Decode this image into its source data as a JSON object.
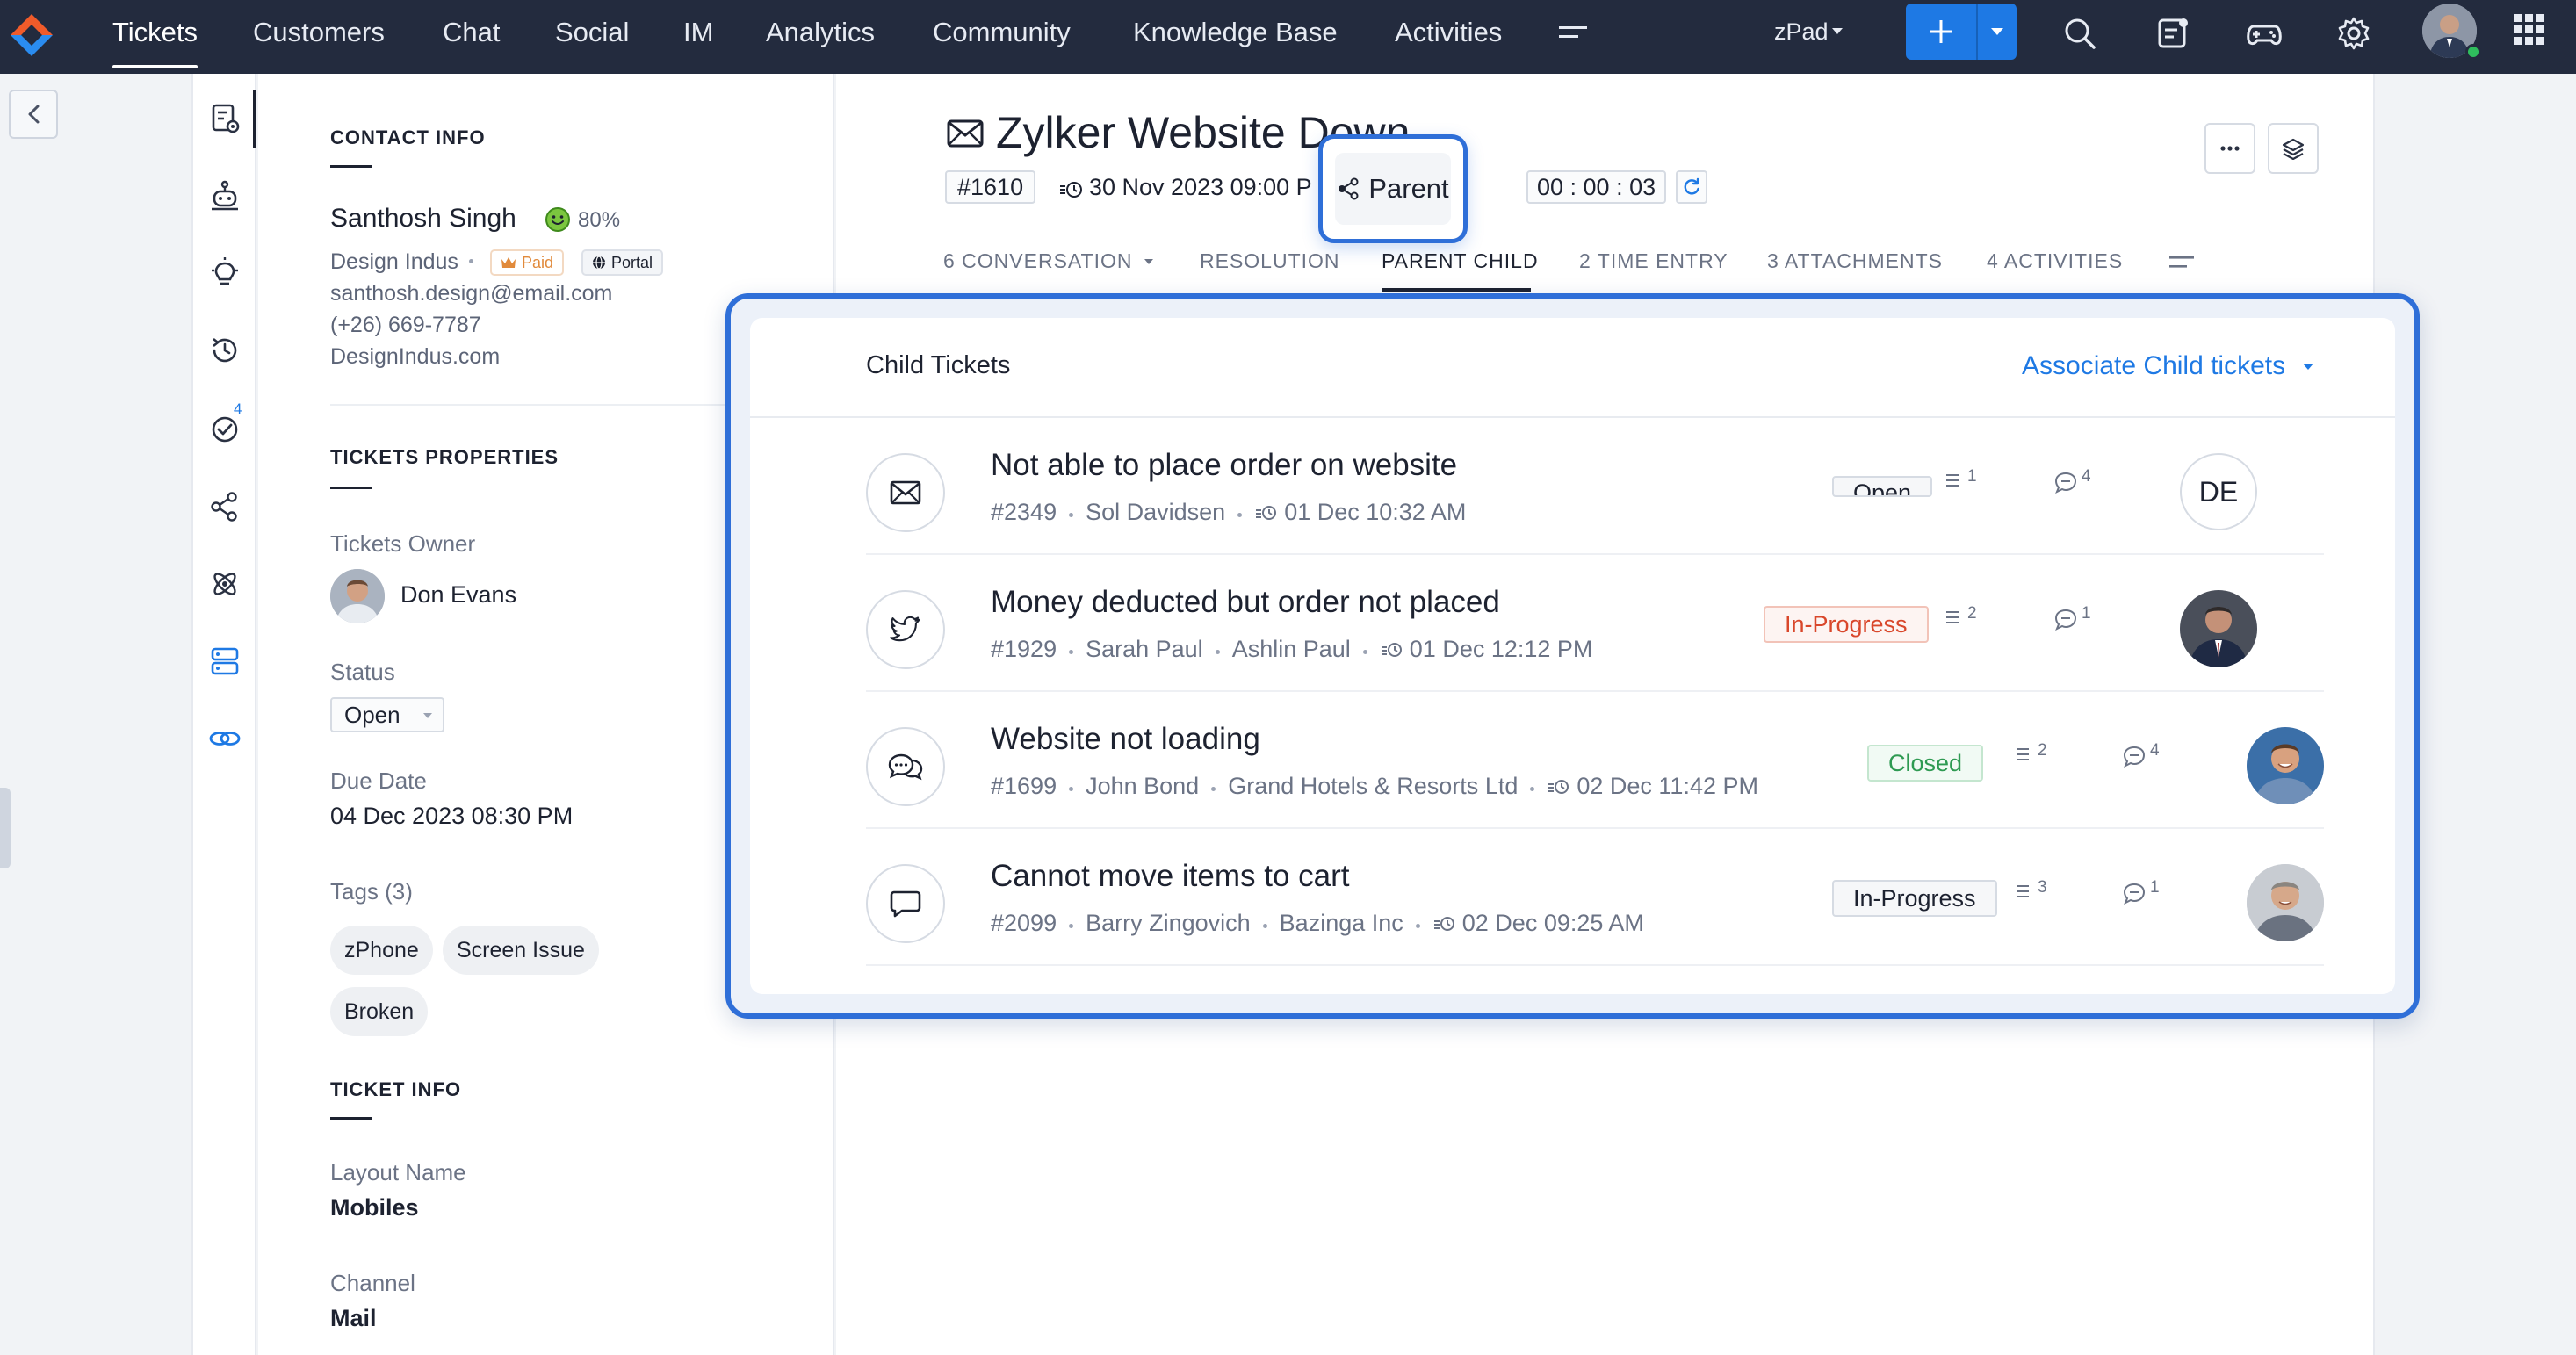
{
  "nav": {
    "items": [
      "Tickets",
      "Customers",
      "Chat",
      "Social",
      "IM",
      "Analytics",
      "Community",
      "Knowledge Base",
      "Activities"
    ],
    "active": "Tickets",
    "department": "zPad"
  },
  "contact": {
    "section_title": "CONTACT INFO",
    "name": "Santhosh Singh",
    "happiness": "80%",
    "account": "Design Indus",
    "badge_paid": "Paid",
    "badge_portal": "Portal",
    "email": "santhosh.design@email.com",
    "phone": "(+26) 669-7787",
    "website": "DesignIndus.com"
  },
  "properties": {
    "section_title": "TICKETS PROPERTIES",
    "owner_label": "Tickets Owner",
    "owner_name": "Don Evans",
    "status_label": "Status",
    "status_value": "Open",
    "due_label": "Due Date",
    "due_value": "04 Dec 2023 08:30 PM",
    "tags_label": "Tags (3)",
    "tags": [
      "zPhone",
      "Screen Issue",
      "Broken"
    ]
  },
  "ticket_info": {
    "section_title": "TICKET INFO",
    "layout_label": "Layout Name",
    "layout_value": "Mobiles",
    "channel_label": "Channel",
    "channel_value": "Mail"
  },
  "ticket": {
    "title": "Zylker Website Down",
    "id": "#1610",
    "date": "30 Nov 2023 09:00 P",
    "parent_label": "Parent",
    "timer": "00 : 00 : 03"
  },
  "tabs": [
    "6 CONVERSATION",
    "RESOLUTION",
    "PARENT CHILD",
    "2 TIME ENTRY",
    "3 ATTACHMENTS",
    "4 ACTIVITIES"
  ],
  "rail_badge": "4",
  "child": {
    "title": "Child Tickets",
    "associate_label": "Associate Child tickets",
    "rows": [
      {
        "title": "Not able to place order on website",
        "id": "#2349",
        "meta": [
          "Sol Davidsen"
        ],
        "date": "01 Dec 10:32 AM",
        "status": "Open",
        "threads": "1",
        "comments": "4",
        "avatar": "DE",
        "channel_icon": "mail-icon"
      },
      {
        "title": "Money deducted but order not placed",
        "id": "#1929",
        "meta": [
          "Sarah Paul",
          "Ashlin Paul"
        ],
        "date": "01 Dec 12:12  PM",
        "status": "In-Progress",
        "threads": "2",
        "comments": "1",
        "avatar": "",
        "channel_icon": "twitter-icon"
      },
      {
        "title": "Website not loading",
        "id": "#1699",
        "meta": [
          "John Bond",
          "Grand Hotels & Resorts Ltd"
        ],
        "date": "02 Dec 11:42  PM",
        "status": "Closed",
        "threads": "2",
        "comments": "4",
        "avatar": "",
        "channel_icon": "chat-bubbles-icon"
      },
      {
        "title": "Cannot move items to cart",
        "id": "#2099",
        "meta": [
          "Barry Zingovich",
          "Bazinga Inc"
        ],
        "date": "02 Dec 09:25  AM",
        "status": "In-Progress",
        "threads": "3",
        "comments": "1",
        "avatar": "",
        "channel_icon": "chat-icon"
      }
    ]
  },
  "colors": {
    "nav_bg": "#232b3e",
    "accent": "#1e79e4",
    "highlight": "#2f6fd8",
    "inprogress": "#d9472b",
    "closed": "#2e9a52"
  }
}
